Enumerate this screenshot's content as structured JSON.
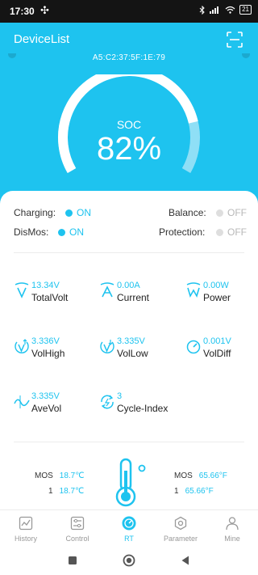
{
  "status_bar": {
    "time": "17:30",
    "battery": "21"
  },
  "header": {
    "title": "DeviceList",
    "mac": "A5:C2:37:5F:1E:79"
  },
  "gauge": {
    "label": "SOC",
    "value_text": "82%",
    "fraction": 0.82
  },
  "switches": [
    {
      "label": "Charging:",
      "state": "ON"
    },
    {
      "label": "Balance:",
      "state": "OFF"
    },
    {
      "label": "DisMos:",
      "state": "ON"
    },
    {
      "label": "Protection:",
      "state": "OFF"
    }
  ],
  "metrics": [
    {
      "value": "13.34V",
      "label": "TotalVolt",
      "icon": "voltage-v-icon"
    },
    {
      "value": "0.00A",
      "label": "Current",
      "icon": "current-a-icon"
    },
    {
      "value": "0.00W",
      "label": "Power",
      "icon": "power-w-icon"
    },
    {
      "value": "3.336V",
      "label": "VolHigh",
      "icon": "voltage-high-icon"
    },
    {
      "value": "3.335V",
      "label": "VolLow",
      "icon": "voltage-low-icon"
    },
    {
      "value": "0.001V",
      "label": "VolDiff",
      "icon": "voltage-diff-icon"
    },
    {
      "value": "3.335V",
      "label": "AveVol",
      "icon": "average-voltage-icon"
    },
    {
      "value": "3",
      "label": "Cycle-Index",
      "icon": "cycle-icon"
    }
  ],
  "temperatures": {
    "left": [
      {
        "name": "MOS",
        "value": "18.7℃"
      },
      {
        "name": "1",
        "value": "18.7℃"
      }
    ],
    "right": [
      {
        "name": "MOS",
        "value": "65.66°F"
      },
      {
        "name": "1",
        "value": "65.66°F"
      }
    ]
  },
  "tabs": [
    {
      "label": "History",
      "icon": "history-chart-icon"
    },
    {
      "label": "Control",
      "icon": "control-sliders-icon"
    },
    {
      "label": "RT",
      "icon": "realtime-gauge-icon",
      "active": true
    },
    {
      "label": "Parameter",
      "icon": "parameter-hex-icon"
    },
    {
      "label": "Mine",
      "icon": "user-icon"
    }
  ],
  "colors": {
    "accent": "#1ec3ef",
    "on": "#1ec3ef",
    "off": "#b8b8b8",
    "status_bar": "#141414"
  }
}
